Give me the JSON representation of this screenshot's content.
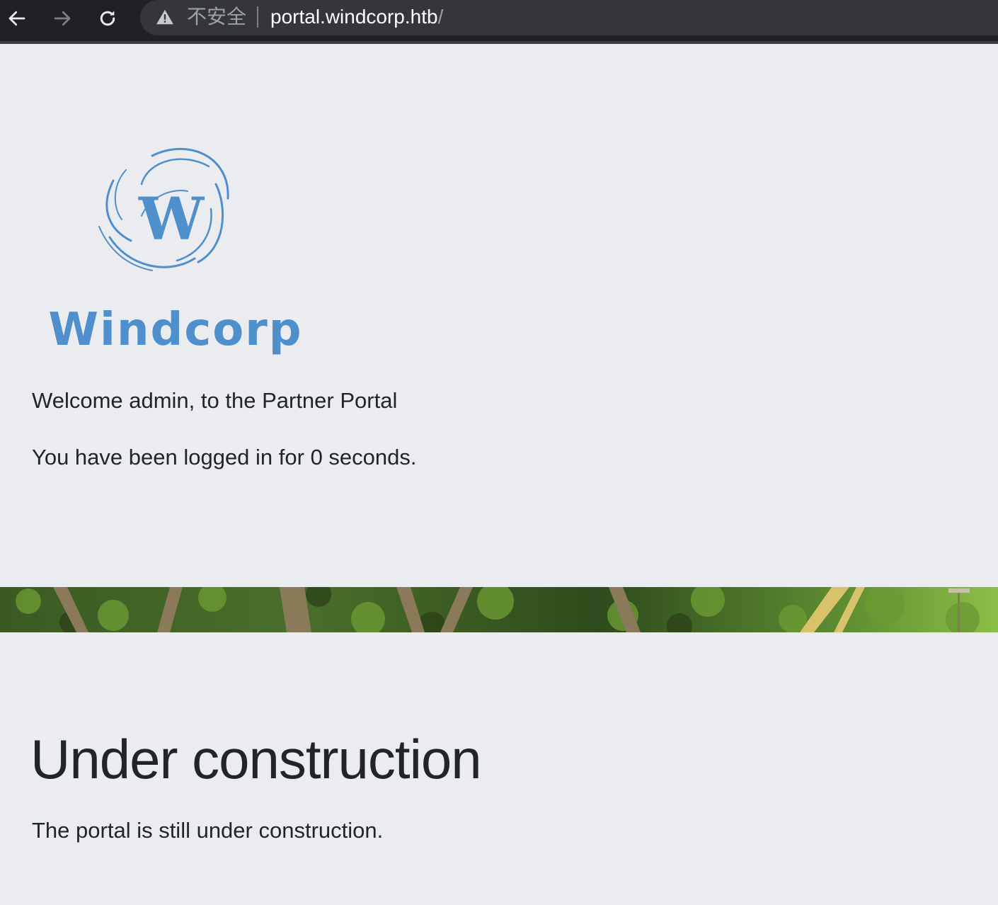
{
  "browser": {
    "security_label": "不安全",
    "url_host": "portal.windcorp.htb",
    "url_path": "/"
  },
  "logo": {
    "text": "Windcorp",
    "letter": "W",
    "color": "#4f8fcb"
  },
  "welcome": {
    "greeting": "Welcome admin, to the Partner Portal",
    "login_duration": "You have been logged in for 0 seconds."
  },
  "main": {
    "heading": "Under construction",
    "description": "The portal is still under construction."
  }
}
